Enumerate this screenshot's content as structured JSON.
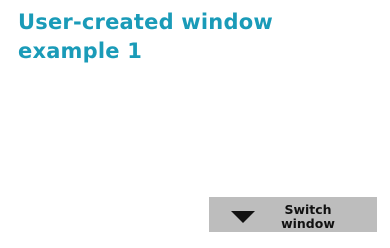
{
  "window": {
    "title": "User-created window example 1"
  },
  "controls": {
    "switch_button": {
      "label": "Switch window",
      "icon": "triangle-down-icon"
    }
  },
  "colors": {
    "title": "#1a9bb8",
    "button_background": "#bdbdbd",
    "button_text": "#111111"
  }
}
